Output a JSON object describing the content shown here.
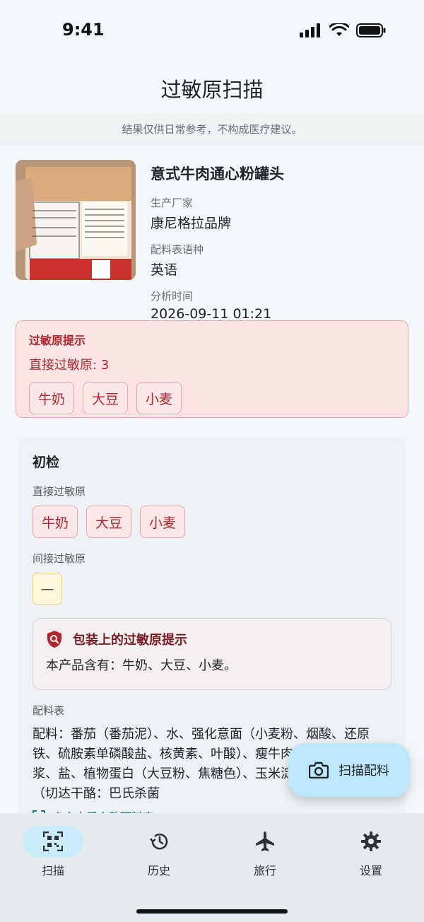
{
  "status": {
    "time": "9:41"
  },
  "page": {
    "title": "过敏原扫描",
    "disclaimer": "结果仅供日常参考，不构成医疗建议。"
  },
  "product": {
    "name": "意式牛肉通心粉罐头",
    "manufacturer_label": "生产厂家",
    "manufacturer": "康尼格拉品牌",
    "language_label": "配料表语种",
    "language": "英语",
    "time_label": "分析时间",
    "time": "2026-09-11 01:21"
  },
  "alert": {
    "title": "过敏原提示",
    "count_text": "直接过敏原: 3",
    "chips": [
      "牛奶",
      "大豆",
      "小麦"
    ]
  },
  "initial": {
    "title": "初检",
    "direct_label": "直接过敏原",
    "direct_chips": [
      "牛奶",
      "大豆",
      "小麦"
    ],
    "indirect_label": "间接过敏原",
    "indirect_value": "—",
    "package_title": "包装上的过敏原提示",
    "package_text": "本产品含有：牛奶、大豆、小麦。",
    "ingredients_label": "配料表",
    "ingredients_text": "配料：番茄（番茄泥）、水、强化意面（小麦粉、烟酸、还原铁、硫胺素单磷酸盐、核黄素、叶酸）、瘦牛肉、高果糖玉米糖浆、盐、植物蛋白（大豆粉、焦糖色）、玉米淀粉、改性奶酪（切达干酪：巴氏杀菌",
    "ingredients_link": "点击查看完整配料表"
  },
  "fab": {
    "label": "扫描配料"
  },
  "nav": {
    "items": [
      {
        "label": "扫描"
      },
      {
        "label": "历史"
      },
      {
        "label": "旅行"
      },
      {
        "label": "设置"
      }
    ]
  },
  "colors": {
    "accent": "#c9ebfa",
    "danger": "#b3262c",
    "warn": "#f1cf73"
  }
}
